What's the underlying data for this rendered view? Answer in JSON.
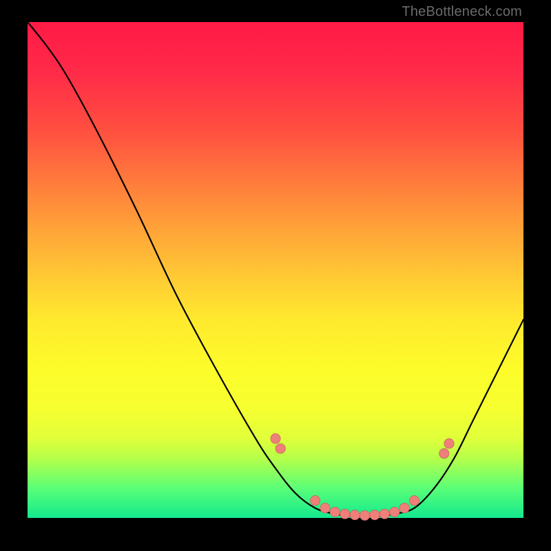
{
  "watermark": "TheBottleneck.com",
  "colors": {
    "dot": "#ef7f79",
    "dot_stroke": "#b55b58",
    "curve": "#000000"
  },
  "chart_data": {
    "type": "line",
    "title": "",
    "xlabel": "",
    "ylabel": "",
    "xlim": [
      0,
      100
    ],
    "ylim": [
      0,
      100
    ],
    "series": [
      {
        "name": "curve",
        "x": [
          0,
          4,
          8,
          14,
          22,
          30,
          38,
          46,
          50,
          54,
          58,
          62,
          66,
          70,
          74,
          78,
          82,
          86,
          90,
          96,
          100
        ],
        "y": [
          100,
          95,
          89,
          78,
          62,
          45,
          30,
          16,
          10,
          5,
          2,
          0.8,
          0.4,
          0.4,
          0.8,
          2,
          6,
          12,
          20,
          32,
          40
        ]
      }
    ],
    "points": [
      {
        "x": 50,
        "y": 16
      },
      {
        "x": 51,
        "y": 14
      },
      {
        "x": 58,
        "y": 3.5
      },
      {
        "x": 60,
        "y": 2.0
      },
      {
        "x": 62,
        "y": 1.2
      },
      {
        "x": 64,
        "y": 0.8
      },
      {
        "x": 66,
        "y": 0.6
      },
      {
        "x": 68,
        "y": 0.5
      },
      {
        "x": 70,
        "y": 0.6
      },
      {
        "x": 72,
        "y": 0.8
      },
      {
        "x": 74,
        "y": 1.2
      },
      {
        "x": 76,
        "y": 2.0
      },
      {
        "x": 78,
        "y": 3.5
      },
      {
        "x": 84,
        "y": 13
      },
      {
        "x": 85,
        "y": 15
      }
    ]
  }
}
